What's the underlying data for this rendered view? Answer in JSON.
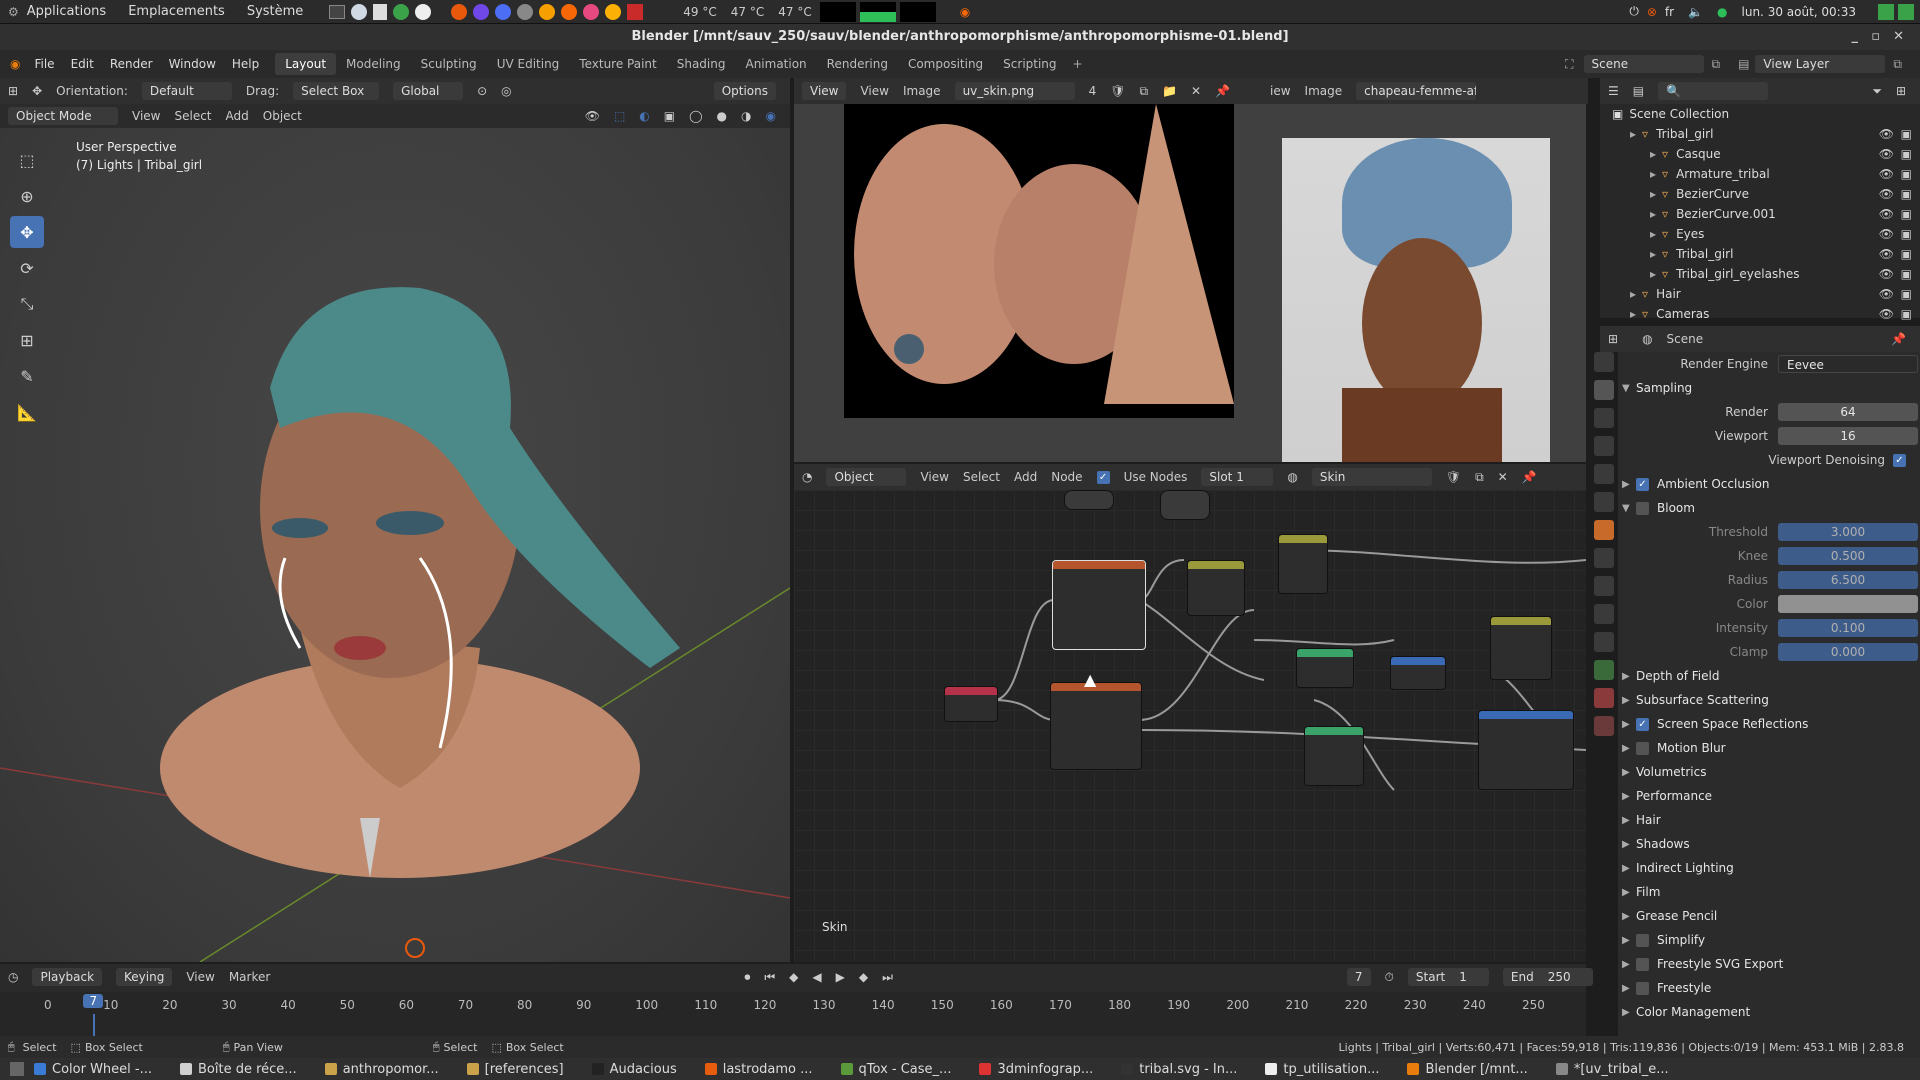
{
  "topbar": {
    "menus": [
      "Applications",
      "Emplacements",
      "Système"
    ],
    "status_temp1": "49 °C",
    "status_temp2": "47 °C",
    "status_temp3": "47 °C",
    "lang": "fr",
    "clock": "lun. 30 août, 00:33"
  },
  "window": {
    "title": "Blender [/mnt/sauv_250/sauv/blender/anthropomorphisme/anthropomorphisme-01.blend]"
  },
  "menubar": {
    "items": [
      "File",
      "Edit",
      "Render",
      "Window",
      "Help"
    ],
    "workspaces": [
      "Layout",
      "Modeling",
      "Sculpting",
      "UV Editing",
      "Texture Paint",
      "Shading",
      "Animation",
      "Rendering",
      "Compositing",
      "Scripting"
    ],
    "scene": "Scene",
    "view_layer": "View Layer"
  },
  "viewport": {
    "orientation_label": "Orientation:",
    "orientation": "Default",
    "drag_label": "Drag:",
    "drag": "Select Box",
    "transform": "Global",
    "options": "Options",
    "mode": "Object Mode",
    "menus": [
      "View",
      "Select",
      "Add",
      "Object"
    ],
    "overlay_title": "User Perspective",
    "overlay_sub": "(7) Lights | Tribal_girl"
  },
  "uv_editor": {
    "menus": [
      "View",
      "View",
      "Image"
    ],
    "image": "uv_skin.png",
    "users": "4"
  },
  "ref_editor": {
    "menus": [
      "iew",
      "Image"
    ],
    "image": "chapeau-femme-afri..."
  },
  "node_editor": {
    "type": "Object",
    "menus": [
      "View",
      "Select",
      "Add",
      "Node"
    ],
    "use_nodes": "Use Nodes",
    "slot": "Slot 1",
    "material": "Skin",
    "footer": "Skin"
  },
  "outliner": {
    "collection": "Scene Collection",
    "items": [
      {
        "name": "Tribal_girl",
        "indent": 0
      },
      {
        "name": "Casque",
        "indent": 1
      },
      {
        "name": "Armature_tribal",
        "indent": 1
      },
      {
        "name": "BezierCurve",
        "indent": 1
      },
      {
        "name": "BezierCurve.001",
        "indent": 1
      },
      {
        "name": "Eyes",
        "indent": 1
      },
      {
        "name": "Tribal_girl",
        "indent": 1
      },
      {
        "name": "Tribal_girl_eyelashes",
        "indent": 1
      },
      {
        "name": "Hair",
        "indent": 0
      },
      {
        "name": "Cameras",
        "indent": 0
      }
    ]
  },
  "props": {
    "scene": "Scene",
    "render_engine_label": "Render Engine",
    "render_engine": "Eevee",
    "sampling": "Sampling",
    "render_label": "Render",
    "render": "64",
    "viewport_label": "Viewport",
    "viewport": "16",
    "denoise": "Viewport Denoising",
    "ao": "Ambient Occlusion",
    "bloom": "Bloom",
    "bloom_fields": [
      {
        "label": "Threshold",
        "value": "3.000"
      },
      {
        "label": "Knee",
        "value": "0.500"
      },
      {
        "label": "Radius",
        "value": "6.500"
      },
      {
        "label": "Color",
        "value": ""
      },
      {
        "label": "Intensity",
        "value": "0.100"
      },
      {
        "label": "Clamp",
        "value": "0.000"
      }
    ],
    "sections": [
      {
        "label": "Depth of Field",
        "check": "none"
      },
      {
        "label": "Subsurface Scattering",
        "check": "none"
      },
      {
        "label": "Screen Space Reflections",
        "check": "on"
      },
      {
        "label": "Motion Blur",
        "check": "off"
      },
      {
        "label": "Volumetrics",
        "check": "none"
      },
      {
        "label": "Performance",
        "check": "none"
      },
      {
        "label": "Hair",
        "check": "none"
      },
      {
        "label": "Shadows",
        "check": "none"
      },
      {
        "label": "Indirect Lighting",
        "check": "none"
      },
      {
        "label": "Film",
        "check": "none"
      },
      {
        "label": "Grease Pencil",
        "check": "none"
      },
      {
        "label": "Simplify",
        "check": "off"
      },
      {
        "label": "Freestyle SVG Export",
        "check": "off"
      },
      {
        "label": "Freestyle",
        "check": "off"
      },
      {
        "label": "Color Management",
        "check": "none"
      }
    ]
  },
  "timeline": {
    "menus": [
      "Playback",
      "Keying",
      "View",
      "Marker"
    ],
    "current": "7",
    "start_label": "Start",
    "start": "1",
    "end_label": "End",
    "end": "250",
    "ticks": [
      "0",
      "10",
      "20",
      "30",
      "40",
      "50",
      "60",
      "70",
      "80",
      "90",
      "100",
      "110",
      "120",
      "130",
      "140",
      "150",
      "160",
      "170",
      "180",
      "190",
      "200",
      "210",
      "220",
      "230",
      "240",
      "250"
    ]
  },
  "statusbar": {
    "left1": "Select",
    "left2": "Box Select",
    "mid1": "Pan View",
    "mid2": "Select",
    "mid3": "Box Select",
    "right": "Lights | Tribal_girl | Verts:60,471 | Faces:59,918 | Tris:119,836 | Objects:0/19 | Mem: 453.1 MiB | 2.83.8"
  },
  "taskbar": {
    "items": [
      {
        "label": "Color Wheel -...",
        "color": "#3a7bd5"
      },
      {
        "label": "Boîte de réce...",
        "color": "#d0d0d0"
      },
      {
        "label": "anthropomor...",
        "color": "#c9a24a"
      },
      {
        "label": "[references]",
        "color": "#c9a24a"
      },
      {
        "label": "Audacious",
        "color": "#222"
      },
      {
        "label": "lastrodamo ...",
        "color": "#e85c0d"
      },
      {
        "label": "qTox - Case_...",
        "color": "#5a9a3a"
      },
      {
        "label": "3dminfograp...",
        "color": "#d33"
      },
      {
        "label": "tribal.svg - In...",
        "color": "#333"
      },
      {
        "label": "tp_utilisation...",
        "color": "#eee"
      },
      {
        "label": "Blender [/mnt...",
        "color": "#e87d0d"
      },
      {
        "label": "*[uv_tribal_e...",
        "color": "#888"
      }
    ]
  }
}
